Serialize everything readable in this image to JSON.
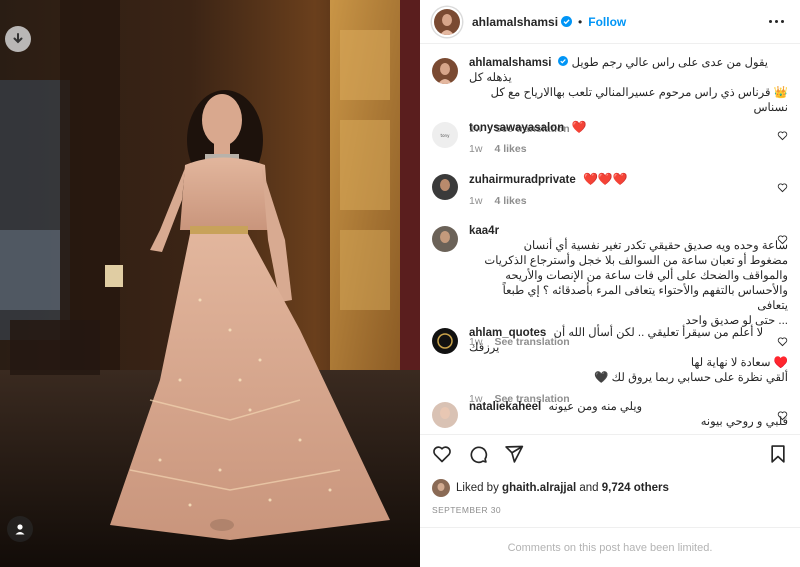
{
  "post": {
    "username": "ahlamalshamsi",
    "follow_label": "Follow",
    "dot": "•",
    "caption_line1": "يقول من عدى على راس عالي رجم طويل يذهله كل",
    "caption_line2": "👑 قرناس ذي راس مرحوم عسيرالمنالي تلعب بهاالارياح مع كل نسناس",
    "caption_age": "1w",
    "see_translation": "See translation"
  },
  "comments": [
    {
      "user": "tonysawayasalon",
      "text": "❤️",
      "age": "1w",
      "likes": "4 likes"
    },
    {
      "user": "zuhairmuradprivate",
      "text": "❤️❤️❤️",
      "age": "1w",
      "likes": "4 likes"
    },
    {
      "user": "kaa4r",
      "lines": [
        "ساعة وحده ويه صديق حقيقي تكدر تغير نفسية أي أنسان",
        "مضغوط أو تعبان ساعة من السوالف بلا خجل وأسترجاع الذكريات",
        "والمواقف والضحك على ألي فات ساعة من الإنصات والأريحه",
        "والأحساس بالتفهم والأحتواء يتعافى المرء بأصدقائه ؟ إي طبعاً يتعافى",
        "... حتى لو صديق واحد"
      ],
      "age": "1w",
      "see_translation": "See translation"
    },
    {
      "user": "ahlam_quotes",
      "lines": [
        "لا أعلم من سيقرأ تعليقي .. لكن أسأل الله أن يرزقك",
        "♥️ سعادة لا نهاية لها",
        "ألقي نظرة على حسابي ربما يروق لك 🖤"
      ],
      "age": "1w",
      "see_translation": "See translation"
    },
    {
      "user": "nataliekaheel",
      "lines": [
        "ويلي منه ومن عيونه",
        "قلبي و روحي بيونه"
      ]
    }
  ],
  "actions": {
    "liked_by_prefix": "Liked by",
    "liked_by_user": "ghaith.alrajjal",
    "liked_by_mid": "and",
    "others": "9,724 others",
    "date": "SEPTEMBER 30",
    "limited": "Comments on this post have been limited."
  },
  "colors": {
    "accent": "#0095f6",
    "heart": "#ed1c3b"
  },
  "icons": [
    "download-icon",
    "tag-person-icon",
    "verified-icon",
    "more-icon",
    "heart-icon",
    "comment-icon",
    "share-icon",
    "bookmark-icon"
  ]
}
